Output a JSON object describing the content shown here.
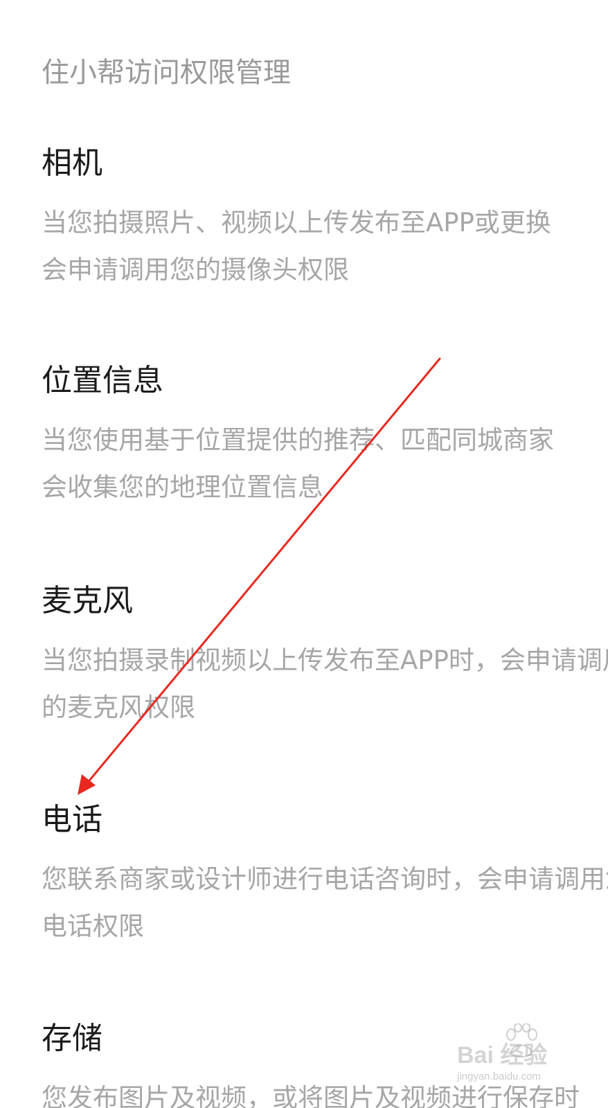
{
  "header": {
    "title": "住小帮访问权限管理"
  },
  "permissions": [
    {
      "title": "相机",
      "desc_line1": "当您拍摄照片、视频以上传发布至APP或更换",
      "desc_line2": "会申请调用您的摄像头权限"
    },
    {
      "title": "位置信息",
      "desc_line1": "当您使用基于位置提供的推荐、匹配同城商家",
      "desc_line2": "会收集您的地理位置信息"
    },
    {
      "title": "麦克风",
      "desc_line1": "当您拍摄录制视频以上传发布至APP时，会申请调用您",
      "desc_line2": "的麦克风权限"
    },
    {
      "title": "电话",
      "desc_line1": "您联系商家或设计师进行电话咨询时，会申请调用您的",
      "desc_line2": "电话权限"
    },
    {
      "title": "存储",
      "desc_line1": "您发布图片及视频，或将图片及视频进行保存时"
    }
  ],
  "annotation": {
    "arrow_color": "#e8281e"
  },
  "watermark": {
    "brand": "Bai  经验",
    "url": "jingyan.baidu.com"
  }
}
